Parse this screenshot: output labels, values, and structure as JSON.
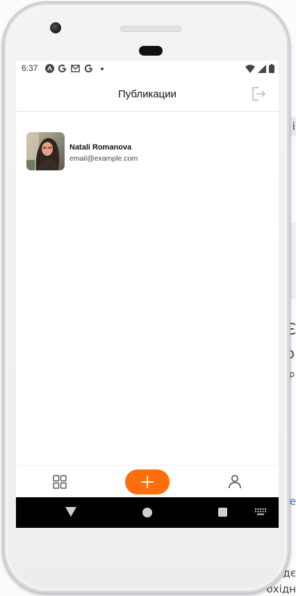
{
  "status_bar": {
    "time": "6:37",
    "left_icons": [
      "android-studio-icon",
      "google-icon",
      "gmail-icon",
      "google-icon",
      "dot-icon"
    ],
    "right_icons": [
      "wifi-icon",
      "signal-icon",
      "battery-icon"
    ]
  },
  "app_bar": {
    "title": "Публикации",
    "action_icon": "logout-icon"
  },
  "user": {
    "name": "Natali Romanova",
    "email": "email@example.com",
    "avatar_icon": "user-photo"
  },
  "bottom_tabs": {
    "left_icon": "grid-icon",
    "center_icon": "plus-icon",
    "right_icon": "person-icon",
    "accent_color": "#ff6e0d"
  },
  "system_nav": {
    "icons": [
      "back-triangle-icon",
      "home-circle-icon",
      "recents-square-icon",
      "keyboard-icon"
    ]
  },
  "background_fragments": {
    "line1": "i",
    "line2": "Є",
    "line3": "р",
    "line4": "р",
    "line5": "е",
    "line6": "дє",
    "line7": "охідн"
  }
}
